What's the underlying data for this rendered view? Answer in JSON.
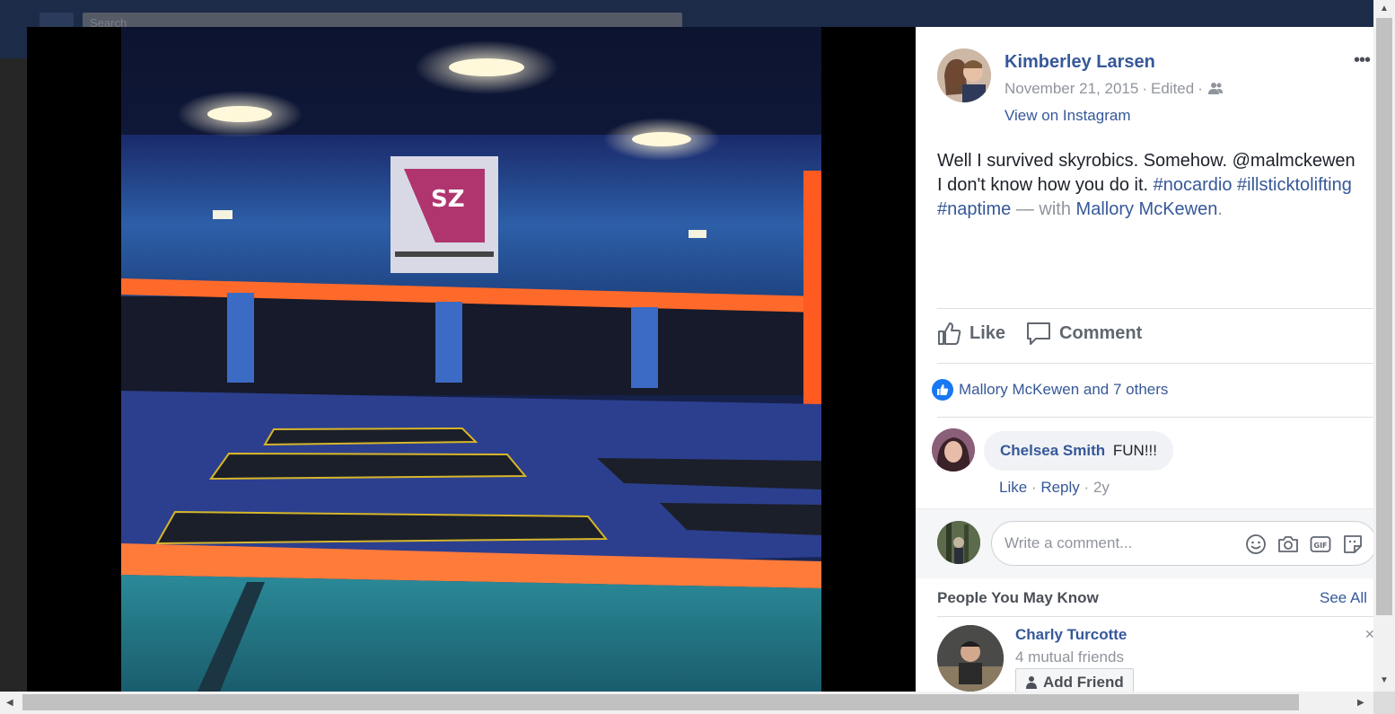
{
  "background": {
    "search_placeholder": "Search"
  },
  "post": {
    "author": "Kimberley Larsen",
    "date": "November 21, 2015",
    "edited": "Edited",
    "separator": "·",
    "view_on_instagram": "View on Instagram",
    "text_line1": "Well I survived skyrobics. Somehow. @malmckewen",
    "text_line2": "I don't know how you do it.",
    "tag_nocardio": "#nocardio",
    "tag_illsticktolifting": "#illsticktolifting",
    "tag_naptime": "#naptime",
    "with_text": "— with",
    "with_person": "Mallory McKewen",
    "period": ".",
    "more_icon": "ellipsis-icon",
    "audience_icon": "friends-icon"
  },
  "actions": {
    "like": "Like",
    "comment": "Comment"
  },
  "reactions": {
    "summary": "Mallory McKewen and 7 others"
  },
  "comments": [
    {
      "name": "Chelsea Smith",
      "text": "FUN!!!",
      "like": "Like",
      "reply": "Reply",
      "age": "2y",
      "sep": "·"
    }
  ],
  "composer": {
    "placeholder": "Write a comment..."
  },
  "pymk": {
    "title": "People You May Know",
    "see_all": "See All",
    "person_name": "Charly Turcotte",
    "mutual": "4 mutual friends",
    "add_friend": "Add Friend"
  },
  "colors": {
    "link": "#365899",
    "like_blue": "#1877f2",
    "muted": "#90949c"
  }
}
